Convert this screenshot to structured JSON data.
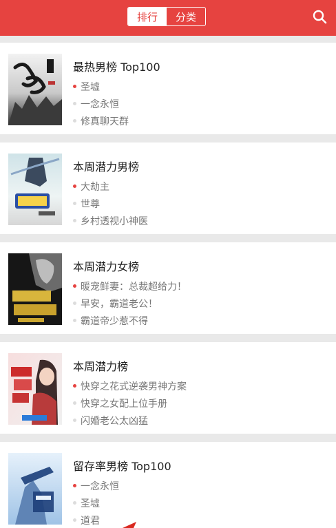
{
  "header": {
    "tabs": [
      {
        "label": "排行",
        "active": true
      },
      {
        "label": "分类",
        "active": false
      }
    ],
    "search_icon": "search-icon",
    "accent_color": "#e64340"
  },
  "rankings": [
    {
      "title": "最热男榜 Top100",
      "cover_icon": "book-cover-image",
      "books": [
        "圣墟",
        "一念永恒",
        "修真聊天群"
      ]
    },
    {
      "title": "本周潜力男榜",
      "cover_icon": "book-cover-image",
      "books": [
        "大劫主",
        "世尊",
        "乡村透视小神医"
      ]
    },
    {
      "title": "本周潜力女榜",
      "cover_icon": "book-cover-image",
      "books": [
        "暖宠鲜妻：总裁超给力！",
        "早安，霸道老公！",
        "霸道帝少惹不得"
      ]
    },
    {
      "title": "本周潜力榜",
      "cover_icon": "book-cover-image",
      "books": [
        "快穿之花式逆袭男神方案",
        "快穿之女配上位手册",
        "闪婚老公太凶猛"
      ]
    },
    {
      "title": "留存率男榜 Top100",
      "cover_icon": "book-cover-image",
      "books": [
        "一念永恒",
        "圣墟",
        "道君"
      ]
    }
  ]
}
